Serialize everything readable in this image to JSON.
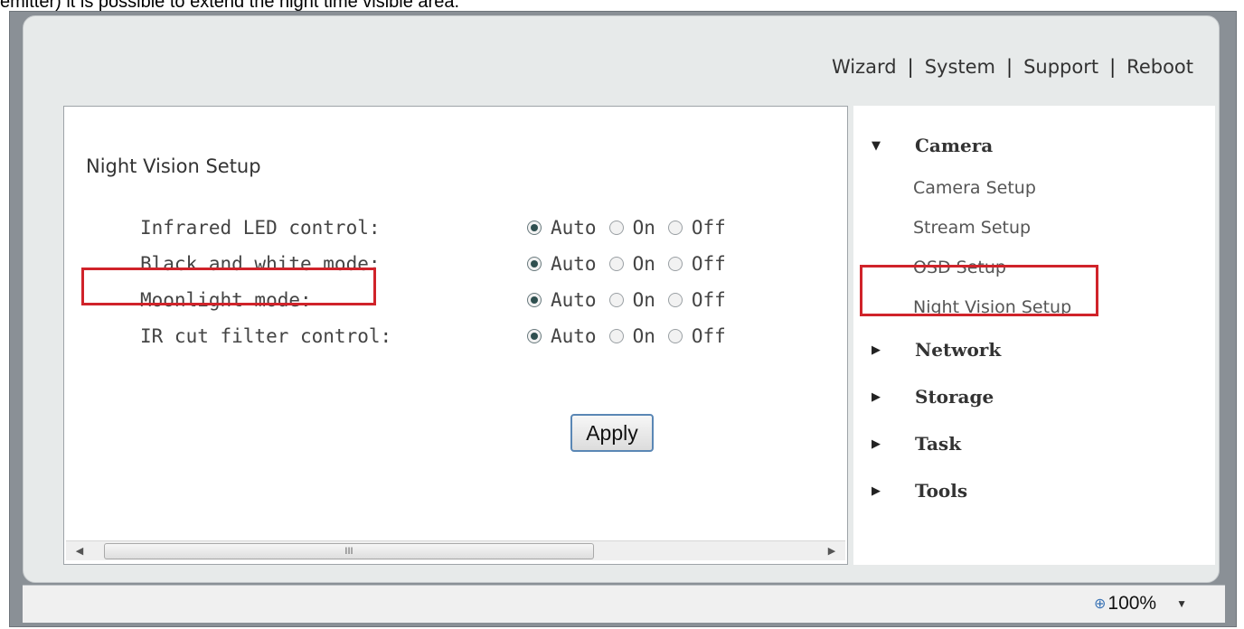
{
  "caption": "emitter) it is possible to extend the night time visible area.",
  "topnav": {
    "wizard": "Wizard",
    "system": "System",
    "support": "Support",
    "reboot": "Reboot",
    "separator": "|"
  },
  "main": {
    "title": "Night Vision Setup",
    "settings": [
      {
        "label": "Infrared LED control:",
        "selected": "Auto"
      },
      {
        "label": "Black and white mode:",
        "selected": "Auto"
      },
      {
        "label": "Moonlight mode:",
        "selected": "Auto"
      },
      {
        "label": "IR cut filter control:",
        "selected": "Auto"
      }
    ],
    "options": [
      "Auto",
      "On",
      "Off"
    ],
    "apply_label": "Apply",
    "scroll_grip": "III"
  },
  "sidebar": {
    "camera": "Camera",
    "camera_items": [
      "Camera Setup",
      "Stream Setup",
      "OSD Setup",
      "Night Vision Setup"
    ],
    "network": "Network",
    "storage": "Storage",
    "task": "Task",
    "tools": "Tools"
  },
  "statusbar": {
    "zoom": "100%"
  },
  "colors": {
    "highlight": "#d0232a"
  },
  "icons": {
    "expanded": "triangle-down-icon",
    "collapsed": "triangle-right-icon",
    "zoom": "magnifier-plus-icon"
  }
}
